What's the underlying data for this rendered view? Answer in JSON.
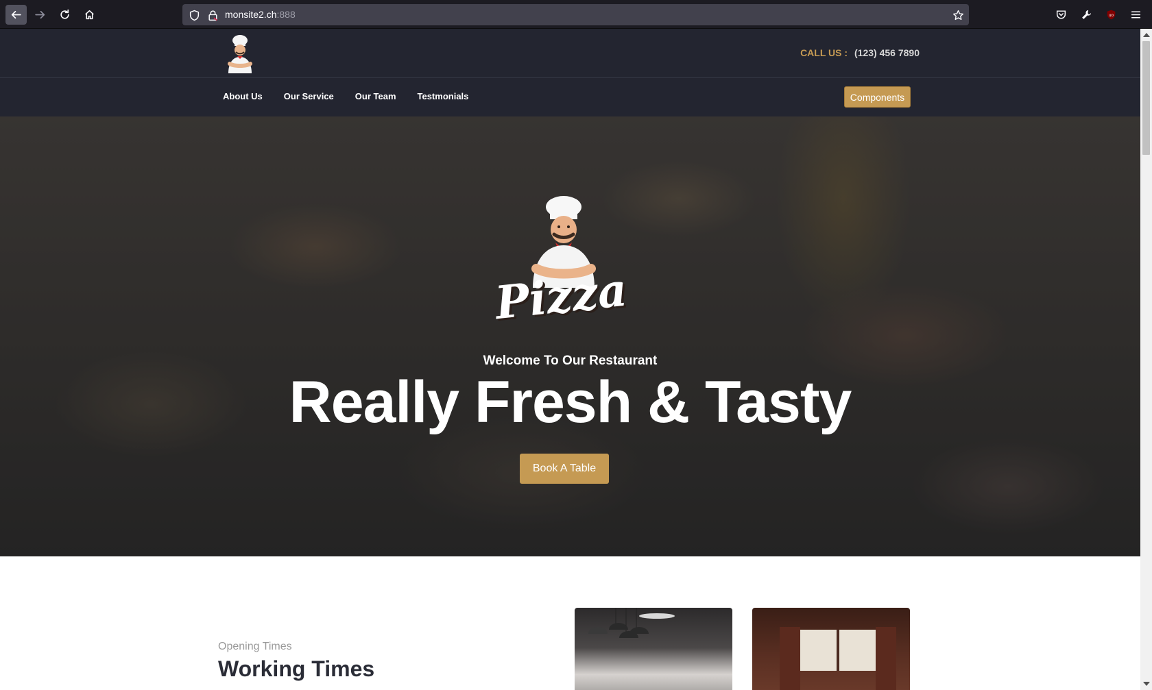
{
  "browser": {
    "url_host": "monsite2.ch",
    "url_port": ":888"
  },
  "header": {
    "call_label": "CALL US :",
    "call_number": "(123) 456 7890"
  },
  "nav": {
    "items": [
      {
        "label": "About Us"
      },
      {
        "label": "Our Service"
      },
      {
        "label": "Our Team"
      },
      {
        "label": "Testmonials"
      }
    ],
    "components_label": "Components"
  },
  "hero": {
    "logo_text": "Pizza",
    "subtitle": "Welcome To Our Restaurant",
    "title": "Really Fresh & Tasty",
    "cta_label": "Book A Table"
  },
  "opening": {
    "subtitle": "Opening Times",
    "title": "Working Times"
  },
  "colors": {
    "accent": "#c59a53",
    "header_bg": "#232530",
    "chrome_bg": "#1c1b22"
  },
  "icons": [
    "back-arrow-icon",
    "forward-arrow-icon",
    "reload-icon",
    "home-icon",
    "shield-icon",
    "lock-icon",
    "star-icon",
    "pocket-icon",
    "wrench-icon",
    "ublock-icon",
    "menu-icon",
    "chef-logo"
  ]
}
